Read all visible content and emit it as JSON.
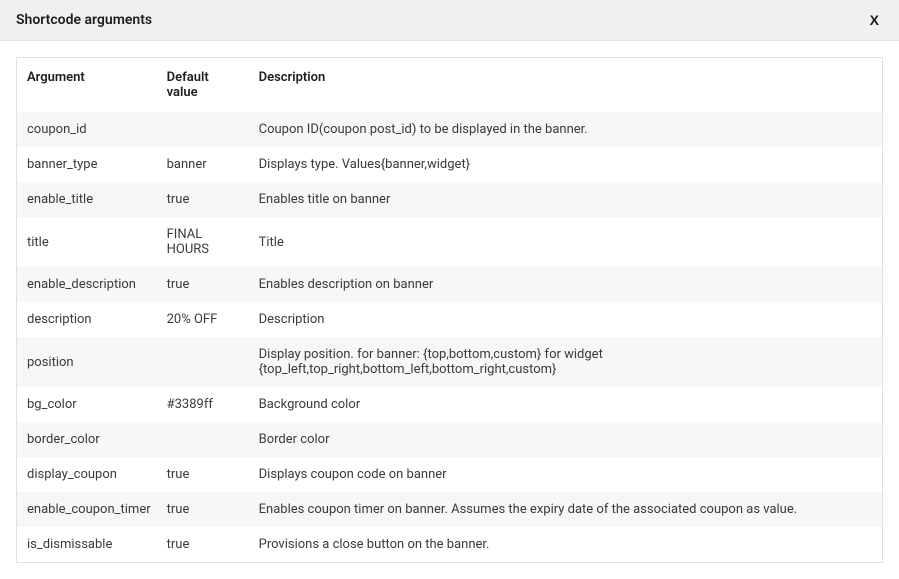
{
  "header": {
    "title": "Shortcode arguments",
    "close_label": "X"
  },
  "table": {
    "headers": {
      "argument": "Argument",
      "default_value": "Default value",
      "description": "Description"
    },
    "rows": [
      {
        "argument": "coupon_id",
        "default_value": "",
        "description": "Coupon ID(coupon post_id) to be displayed in the banner."
      },
      {
        "argument": "banner_type",
        "default_value": "banner",
        "description": "Displays type. Values{banner,widget}"
      },
      {
        "argument": "enable_title",
        "default_value": "true",
        "description": "Enables title on banner"
      },
      {
        "argument": "title",
        "default_value": "FINAL HOURS",
        "description": "Title"
      },
      {
        "argument": "enable_description",
        "default_value": "true",
        "description": "Enables description on banner"
      },
      {
        "argument": "description",
        "default_value": "20% OFF",
        "description": "Description"
      },
      {
        "argument": "position",
        "default_value": "",
        "description": "Display position. for banner: {top,bottom,custom} for widget {top_left,top_right,bottom_left,bottom_right,custom}"
      },
      {
        "argument": "bg_color",
        "default_value": "#3389ff",
        "description": "Background color"
      },
      {
        "argument": "border_color",
        "default_value": "",
        "description": "Border color"
      },
      {
        "argument": "display_coupon",
        "default_value": "true",
        "description": "Displays coupon code on banner"
      },
      {
        "argument": "enable_coupon_timer",
        "default_value": "true",
        "description": "Enables coupon timer on banner. Assumes the expiry date of the associated coupon as value."
      },
      {
        "argument": "is_dismissable",
        "default_value": "true",
        "description": "Provisions a close button on the banner."
      }
    ]
  }
}
